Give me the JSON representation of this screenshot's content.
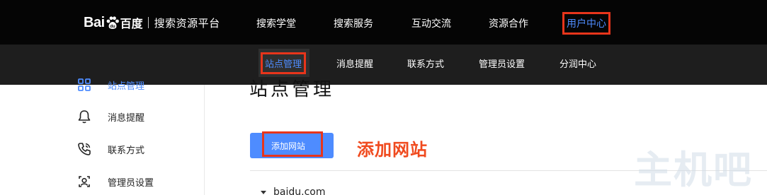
{
  "brand": {
    "logo_text_en": "Bai",
    "logo_text_cn": "百度",
    "platform_name": "搜索资源平台"
  },
  "topnav": {
    "items": [
      {
        "label": "搜索学堂"
      },
      {
        "label": "搜索服务"
      },
      {
        "label": "互动交流"
      },
      {
        "label": "资源合作"
      },
      {
        "label": "用户中心",
        "active": true
      }
    ]
  },
  "subnav": {
    "items": [
      {
        "label": "站点管理",
        "active": true
      },
      {
        "label": "消息提醒"
      },
      {
        "label": "联系方式"
      },
      {
        "label": "管理员设置"
      },
      {
        "label": "分润中心"
      }
    ]
  },
  "sidebar": {
    "items": [
      {
        "label": "站点管理",
        "icon": "grid-icon",
        "active": true
      },
      {
        "label": "消息提醒",
        "icon": "bell-icon"
      },
      {
        "label": "联系方式",
        "icon": "phone-icon"
      },
      {
        "label": "管理员设置",
        "icon": "admin-user-icon"
      }
    ]
  },
  "main": {
    "title": "站点管理",
    "add_button_label": "添加网站",
    "annotation": "添加网站",
    "site": {
      "name": "baidu.com"
    }
  },
  "watermark": "主机吧",
  "colors": {
    "accent": "#4e8cff",
    "highlight_box": "#e8351b",
    "annotation": "#f04a1e",
    "topnav_bg": "#050505",
    "subnav_bg": "#1e1e1e"
  }
}
